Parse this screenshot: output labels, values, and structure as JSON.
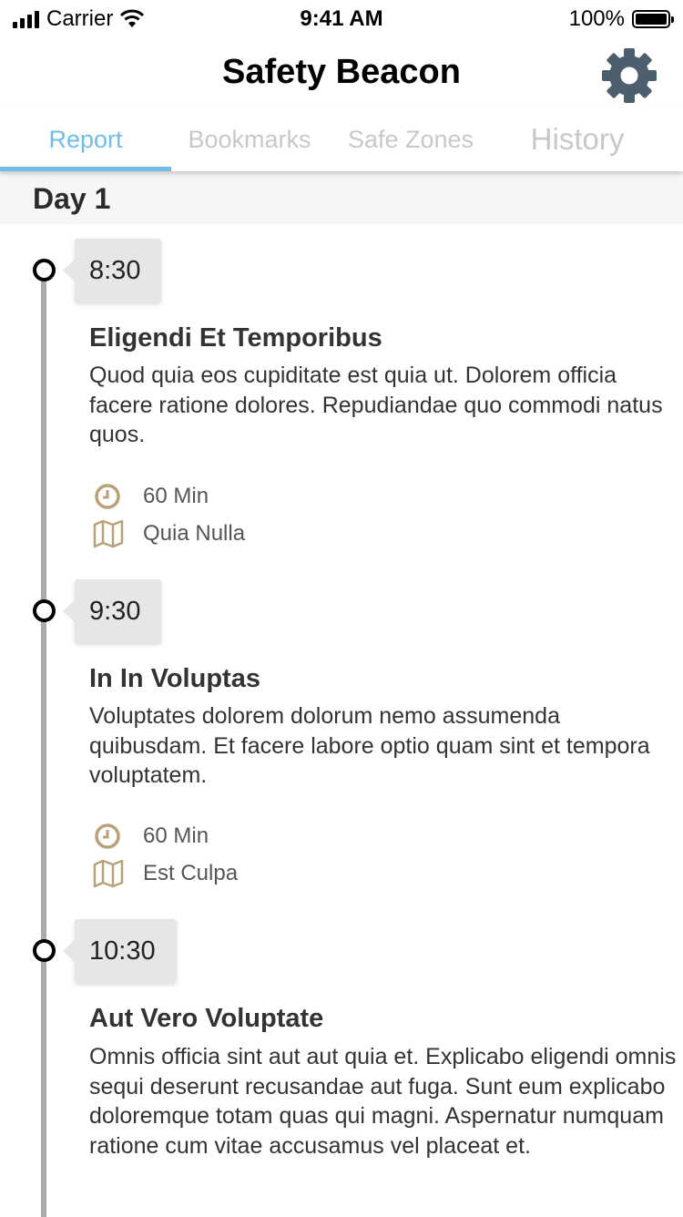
{
  "status_bar": {
    "carrier": "Carrier",
    "time": "9:41 AM",
    "battery": "100%"
  },
  "header": {
    "title": "Safety Beacon",
    "settings_icon": "gear-icon"
  },
  "tabs": [
    {
      "label": "Report",
      "active": true
    },
    {
      "label": "Bookmarks",
      "active": false
    },
    {
      "label": "Safe Zones",
      "active": false
    },
    {
      "label": "History",
      "active": false
    }
  ],
  "day": "Day 1",
  "events": [
    {
      "time": "8:30",
      "title": "Eligendi Et Temporibus",
      "description": "Quod quia eos cupiditate est quia ut. Dolorem officia facere ratione dolores. Repudiandae quo commodi natus quos.",
      "duration": "60 Min",
      "location": "Quia Nulla"
    },
    {
      "time": "9:30",
      "title": "In In Voluptas",
      "description": "Voluptates dolorem dolorum nemo assumenda quibusdam. Et facere labore optio quam sint et tempora voluptatem.",
      "duration": "60 Min",
      "location": "Est Culpa"
    },
    {
      "time": "10:30",
      "title": "Aut Vero Voluptate",
      "description": "Omnis officia sint aut aut quia et. Explicabo eligendi omnis sequi deserunt recusandae aut fuga. Sunt eum explicabo doloremque totam quas qui magni. Aspernatur numquam ratione cum vitae accusamus vel placeat et."
    }
  ],
  "colors": {
    "accent": "#72bde8",
    "icon_gold": "#b9a27a",
    "gear": "#4d5f6e",
    "timeline": "#aaaaaa"
  }
}
